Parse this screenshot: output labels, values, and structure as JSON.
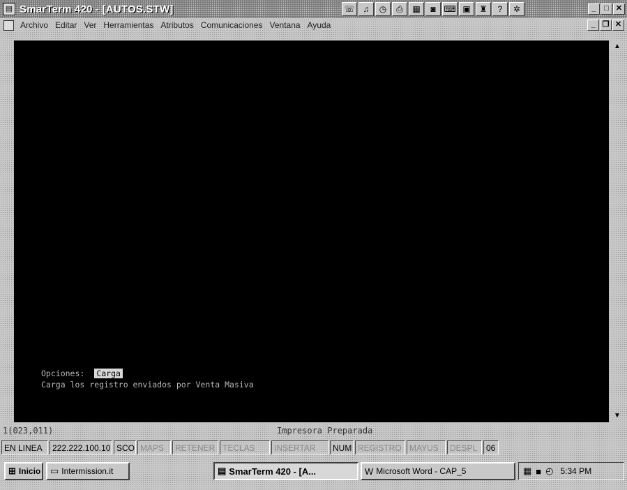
{
  "window": {
    "title": "SmarTerm 420 - [AUTOS.STW]",
    "app_icon": "terminal-icon",
    "toolbar_icons": [
      "phone-icon",
      "bell-icon",
      "clock-icon",
      "print-icon",
      "folder-icon",
      "disk-icon",
      "keyboard-icon",
      "document-icon",
      "macro-icon",
      "help-icon",
      "settings-icon"
    ],
    "controls": {
      "minimize": "_",
      "maximize": "□",
      "close": "✕"
    }
  },
  "menu": {
    "items": [
      "Archivo",
      "Editar",
      "Ver",
      "Herramientas",
      "Atributos",
      "Comunicaciones",
      "Ventana",
      "Ayuda"
    ],
    "doc_controls": {
      "minimize": "_",
      "restore": "❐",
      "close": "✕"
    }
  },
  "terminal": {
    "options_label": "Opciones:",
    "selected_option": "Carga",
    "help_line": "Carga los registro enviados por Venta Masiva",
    "background": "#000000",
    "text_color": "#b8b8b8"
  },
  "status": {
    "cursor_pos": "1(023,011)",
    "printer": "Impresora Preparada"
  },
  "indicators": [
    {
      "label": "EN LINEA",
      "active": true
    },
    {
      "label": "222.222.100.10",
      "active": true
    },
    {
      "label": "SCO",
      "active": true
    },
    {
      "label": "MAPS",
      "active": false
    },
    {
      "label": "RETENER",
      "active": false
    },
    {
      "label": "TECLAS",
      "active": false
    },
    {
      "label": "INSERTAR",
      "active": false
    },
    {
      "label": "NUM",
      "active": true
    },
    {
      "label": "REGISTRO",
      "active": false
    },
    {
      "label": "MAYUS",
      "active": false
    },
    {
      "label": "DESPL",
      "active": false
    },
    {
      "label": "06",
      "active": true
    }
  ],
  "taskbar": {
    "start": "Inicio",
    "tasks": [
      "Intermission.it",
      "SmarTerm 420 - [A...",
      "Microsoft Word - CAP_5"
    ],
    "clock": "5:34 PM"
  }
}
